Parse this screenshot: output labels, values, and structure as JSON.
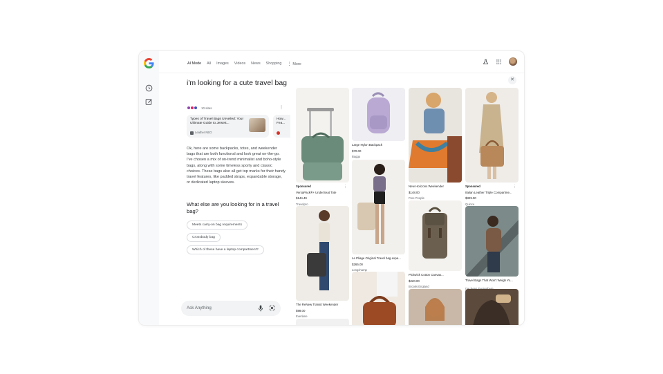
{
  "header": {
    "tabs": [
      {
        "label": "AI Mode",
        "active": true
      },
      {
        "label": "All"
      },
      {
        "label": "Images"
      },
      {
        "label": "Videos"
      },
      {
        "label": "News"
      },
      {
        "label": "Shopping"
      },
      {
        "label": "More"
      }
    ],
    "icons": [
      "flask-icon",
      "apps-grid-icon",
      "avatar"
    ]
  },
  "rail": {
    "icons": [
      "google-logo",
      "history-icon",
      "new-chat-icon"
    ]
  },
  "conversation": {
    "question": "i'm looking for a cute travel bag",
    "sources_count": "10 sites",
    "source_cards": [
      {
        "title": "Types of Travel Bags Unveiled: Your Ultimate Guide to Jetsett...",
        "source": "Leather NEO"
      },
      {
        "title": "How... Fea...",
        "source": ""
      }
    ],
    "answer": "Ok, here are some backpacks, totes, and weekender bags that are both functional and look great on-the-go. I've chosen a mix of on-trend minimalist and boho-style bags, along with some timeless sporty and classic choices. These bags also all get top marks for their handy travel features, like padded straps, expandable storage, or dedicated laptop sleeves.",
    "followup_question": "What else are you looking for in a travel bag?",
    "chips": [
      "Meets carry-on bag requirements",
      "Crossbody bag",
      "Which of these have a laptop compartment?"
    ]
  },
  "ask": {
    "placeholder": "Ask Anything"
  },
  "products": {
    "col1": [
      {
        "sponsored": "Sponsored",
        "name": "VersaPack®+ UnderSeat Tote",
        "price": "$144.49",
        "store": "Travelpro"
      },
      {
        "sponsored": "",
        "name": "The ReNew Transit Weekender",
        "price": "$98.00",
        "store": "Everlane"
      }
    ],
    "col2": [
      {
        "sponsored": "",
        "name": "Large Nylon Backpack",
        "price": "$70.00",
        "store": "Baggu"
      },
      {
        "sponsored": "",
        "name": "Le Pliage Original Travel bag expa...",
        "price": "$265.00",
        "store": "Longchamp"
      }
    ],
    "col3": [
      {
        "sponsored": "",
        "name": "New Horizons Weekender",
        "price": "$148.00",
        "store": "Free People"
      },
      {
        "sponsored": "",
        "name": "Pickwick Cotton Canvas...",
        "price": "$220.00",
        "store": "Brooks England"
      }
    ],
    "col4": [
      {
        "sponsored": "Sponsored",
        "name": "Italian Leather Triple Compartme...",
        "price": "$329.90",
        "store": "Quince"
      },
      {
        "sponsored": "",
        "name": "Travel Bags That Won't Weigh Yo...",
        "price": "",
        "store": "I've Been Everywhere"
      }
    ]
  },
  "colors": {
    "accent": "#1a73e8",
    "chip_border": "#dadce0",
    "surface": "#f1f3f4"
  }
}
